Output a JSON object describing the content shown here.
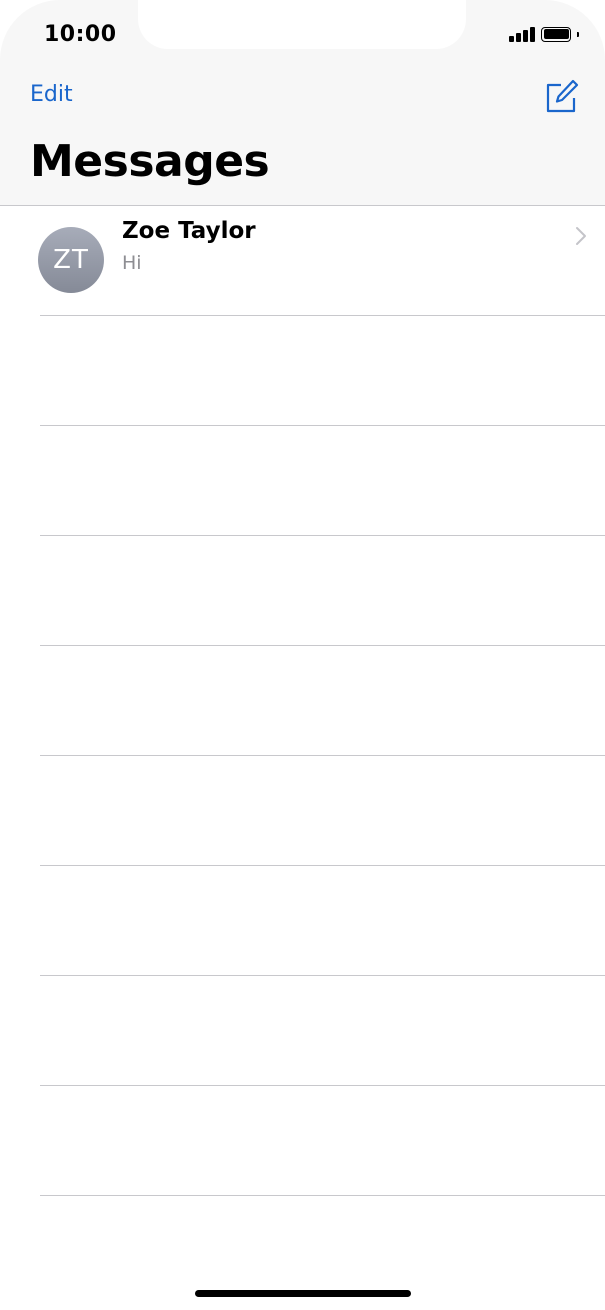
{
  "status_bar": {
    "time": "10:00"
  },
  "nav": {
    "edit_label": "Edit",
    "compose_icon": "compose-icon",
    "title": "Messages"
  },
  "conversations": [
    {
      "initials": "ZT",
      "name": "Zoe Taylor",
      "preview": "Hi"
    }
  ],
  "colors": {
    "accent": "#1a66cc",
    "header_bg": "#f7f7f7",
    "separator": "#c8c8cc",
    "secondary_text": "#8e8e93"
  }
}
